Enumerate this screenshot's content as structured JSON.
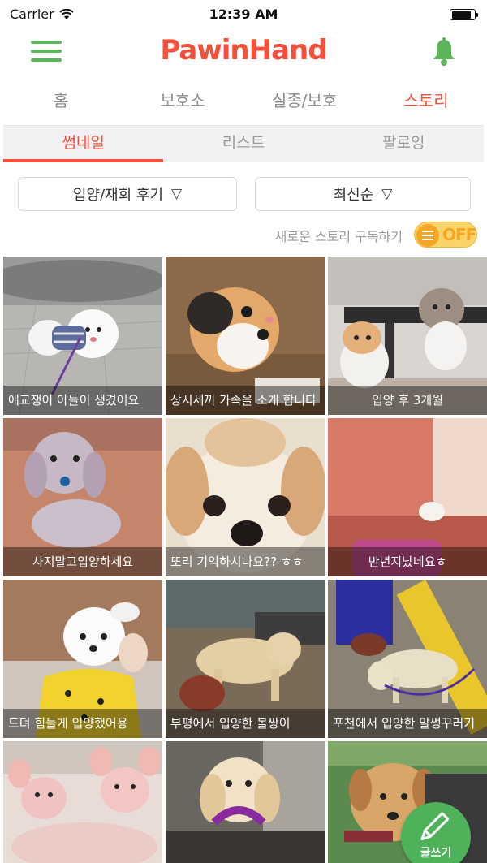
{
  "status_bar": {
    "carrier": "Carrier",
    "time": "12:39 AM"
  },
  "header": {
    "logo_text": "PawinHand",
    "menu_icon": "hamburger-menu-icon",
    "bell_icon": "bell-icon"
  },
  "main_tabs": [
    {
      "label": "홈",
      "active": false
    },
    {
      "label": "보호소",
      "active": false
    },
    {
      "label": "실종/보호",
      "active": false
    },
    {
      "label": "스토리",
      "active": true
    }
  ],
  "sub_tabs": [
    {
      "label": "썸네일",
      "active": true
    },
    {
      "label": "리스트",
      "active": false
    },
    {
      "label": "팔로잉",
      "active": false
    }
  ],
  "filters": {
    "category": "입양/재회 후기",
    "sort": "최신순",
    "dropdown_glyph": "▽"
  },
  "subscribe": {
    "label": "새로운 스토리 구독하기",
    "toggle_text": "OFF"
  },
  "stories": [
    {
      "caption": "애교쟁이 아들이 생겼어요"
    },
    {
      "caption": "상시세끼 가족을 소개 합니다"
    },
    {
      "caption": "입양 후 3개월"
    },
    {
      "caption": "사지말고입양하세요"
    },
    {
      "caption": "또리 기억하시나요?? ㅎㅎ"
    },
    {
      "caption": "반년지났네요ㅎ"
    },
    {
      "caption": "드뎌 힘들게 입양했어용"
    },
    {
      "caption": "부평에서 입양한 볼쌍이"
    },
    {
      "caption": "포천에서 입양한 말썽꾸러기"
    },
    {
      "caption": ""
    },
    {
      "caption": ""
    },
    {
      "caption": ""
    }
  ],
  "fab": {
    "label": "글쓰기"
  },
  "colors": {
    "accent": "#f4503c",
    "green": "#5cb55a",
    "toggle": "#f5a623",
    "fab": "#4db25a"
  }
}
